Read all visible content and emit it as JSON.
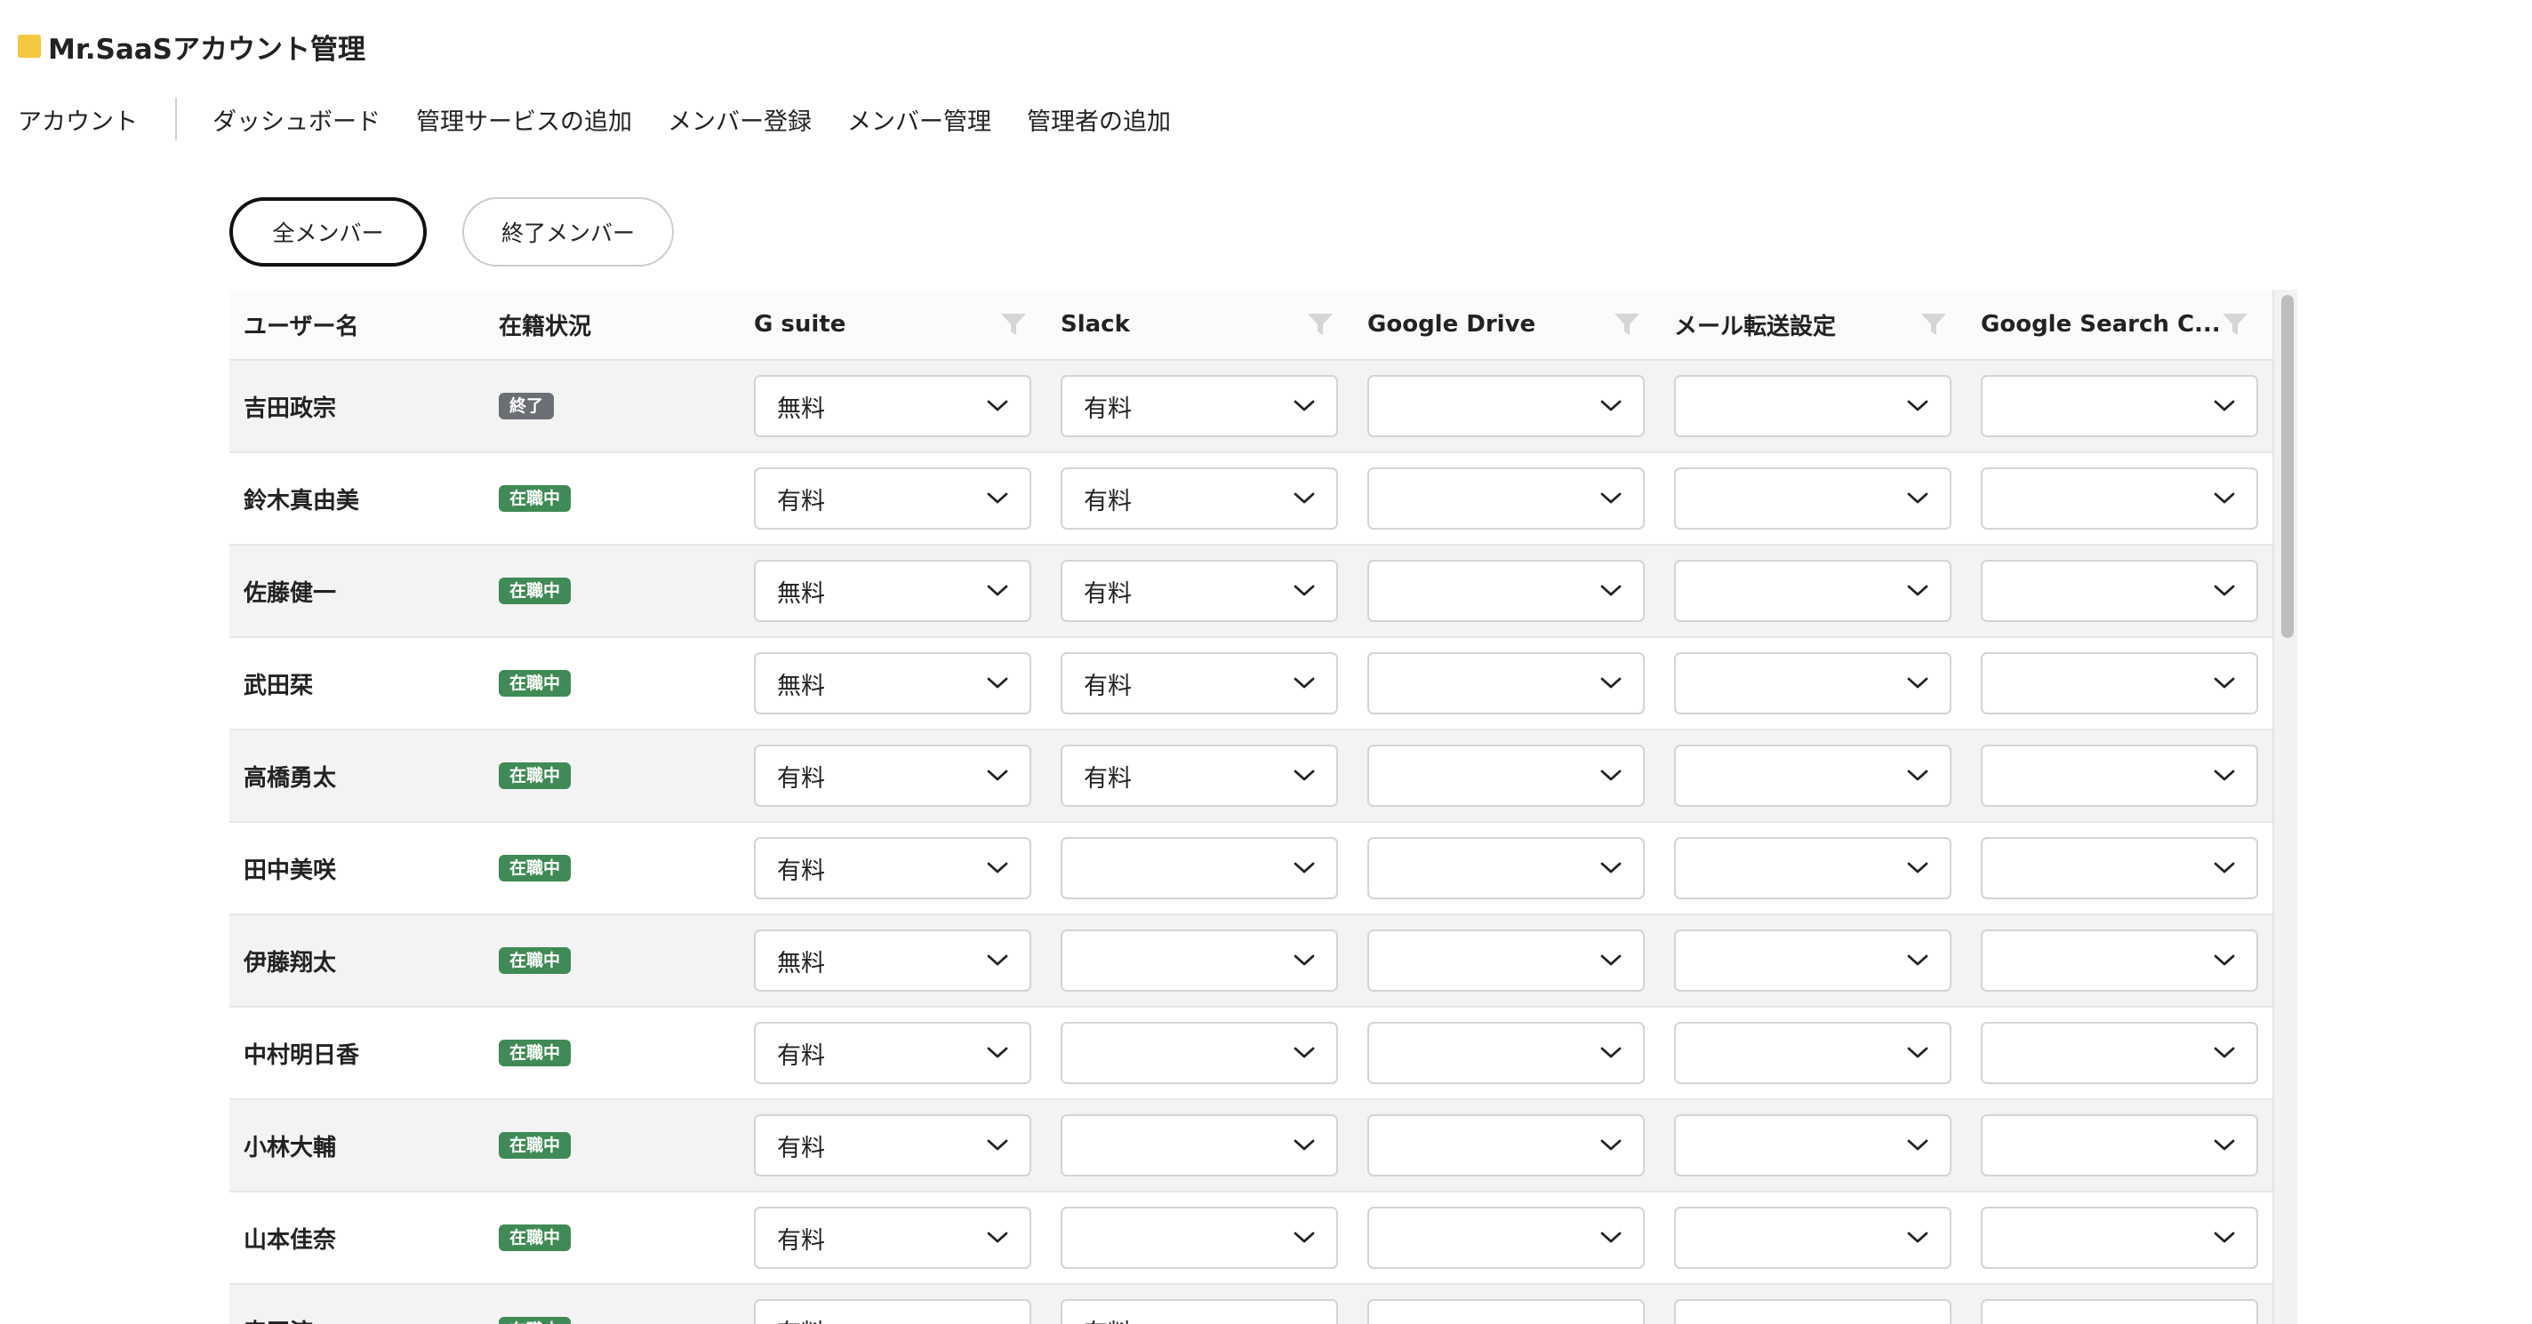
{
  "app": {
    "title": "Mr.SaaSアカウント管理",
    "accent": "#f5c842"
  },
  "nav": {
    "account": "アカウント",
    "links": [
      "ダッシュボード",
      "管理サービスの追加",
      "メンバー登録",
      "メンバー管理",
      "管理者の追加"
    ]
  },
  "tabs": {
    "all": "全メンバー",
    "ended": "終了メンバー",
    "active": "all"
  },
  "table": {
    "headers": {
      "user": "ユーザー名",
      "status": "在籍状況",
      "services": [
        "G suite",
        "Slack",
        "Google Drive",
        "メール転送設定",
        "Google Search C..."
      ]
    },
    "status_colors": {
      "終了": "#6b6e73",
      "在職中": "#3f8a55"
    },
    "rows": [
      {
        "user": "吉田政宗",
        "status": "終了",
        "status_type": "ended",
        "values": [
          "無料",
          "有料",
          "",
          "",
          ""
        ]
      },
      {
        "user": "鈴木真由美",
        "status": "在職中",
        "status_type": "employed",
        "values": [
          "有料",
          "有料",
          "",
          "",
          ""
        ]
      },
      {
        "user": "佐藤健一",
        "status": "在職中",
        "status_type": "employed",
        "values": [
          "無料",
          "有料",
          "",
          "",
          ""
        ]
      },
      {
        "user": "武田栞",
        "status": "在職中",
        "status_type": "employed",
        "values": [
          "無料",
          "有料",
          "",
          "",
          ""
        ]
      },
      {
        "user": "高橋勇太",
        "status": "在職中",
        "status_type": "employed",
        "values": [
          "有料",
          "有料",
          "",
          "",
          ""
        ]
      },
      {
        "user": "田中美咲",
        "status": "在職中",
        "status_type": "employed",
        "values": [
          "有料",
          "",
          "",
          "",
          ""
        ]
      },
      {
        "user": "伊藤翔太",
        "status": "在職中",
        "status_type": "employed",
        "values": [
          "無料",
          "",
          "",
          "",
          ""
        ]
      },
      {
        "user": "中村明日香",
        "status": "在職中",
        "status_type": "employed",
        "values": [
          "有料",
          "",
          "",
          "",
          ""
        ]
      },
      {
        "user": "小林大輔",
        "status": "在職中",
        "status_type": "employed",
        "values": [
          "有料",
          "",
          "",
          "",
          ""
        ]
      },
      {
        "user": "山本佳奈",
        "status": "在職中",
        "status_type": "employed",
        "values": [
          "有料",
          "",
          "",
          "",
          ""
        ]
      },
      {
        "user": "森田涼",
        "status": "在職中",
        "status_type": "employed",
        "values": [
          "有料",
          "有料",
          "",
          "",
          ""
        ]
      }
    ]
  }
}
